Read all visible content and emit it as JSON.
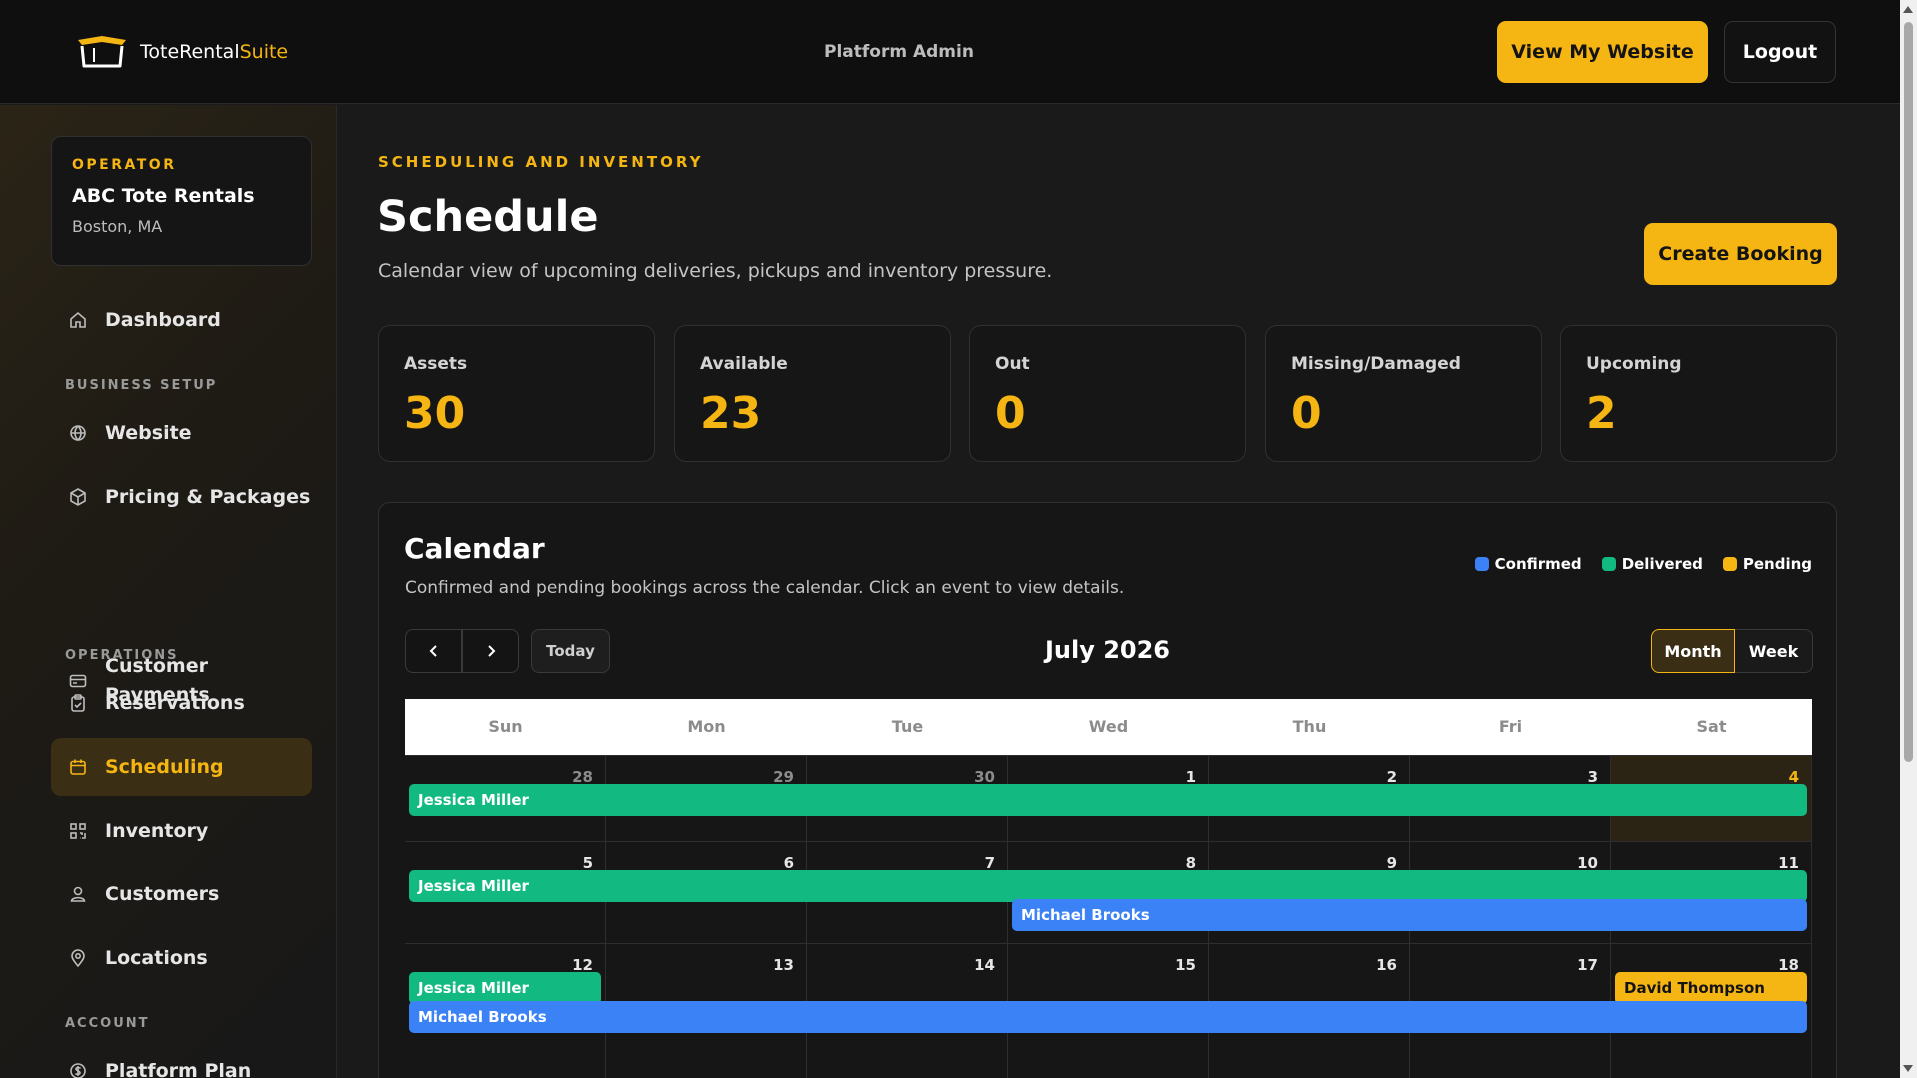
{
  "header": {
    "logo_text_main": "ToteRental",
    "logo_text_accent": "Suite",
    "center_label": "Platform Admin",
    "view_site_label": "View My Website",
    "logout_label": "Logout",
    "accent_color": "#f5b512"
  },
  "operator": {
    "kicker": "OPERATOR",
    "name": "ABC Tote Rentals",
    "location": "Boston, MA"
  },
  "sidebar": {
    "dashboard": "Dashboard",
    "section_business": "BUSINESS SETUP",
    "website": "Website",
    "pricing": "Pricing & Packages",
    "payments_line1": "Customer",
    "payments_line2": "Payments",
    "section_operations": "OPERATIONS",
    "reservations": "Reservations",
    "scheduling": "Scheduling",
    "inventory": "Inventory",
    "customers": "Customers",
    "locations": "Locations",
    "section_account": "ACCOUNT",
    "platform_plan": "Platform Plan"
  },
  "page": {
    "kicker": "SCHEDULING AND INVENTORY",
    "title": "Schedule",
    "subtitle": "Calendar view of upcoming deliveries, pickups and inventory pressure.",
    "create_label": "Create Booking"
  },
  "stats": [
    {
      "label": "Assets",
      "value": "30"
    },
    {
      "label": "Available",
      "value": "23"
    },
    {
      "label": "Out",
      "value": "0"
    },
    {
      "label": "Missing/Damaged",
      "value": "0"
    },
    {
      "label": "Upcoming",
      "value": "2"
    }
  ],
  "calendar": {
    "title": "Calendar",
    "subtitle": "Confirmed and pending bookings across the calendar. Click an event to view details.",
    "legend": [
      {
        "label": "Confirmed",
        "color": "#3b82f6"
      },
      {
        "label": "Delivered",
        "color": "#12b981"
      },
      {
        "label": "Pending",
        "color": "#f5b512"
      }
    ],
    "today_label": "Today",
    "month_label": "July 2026",
    "view_month": "Month",
    "view_week": "Week",
    "weekdays": [
      "Sun",
      "Mon",
      "Tue",
      "Wed",
      "Thu",
      "Fri",
      "Sat"
    ],
    "weeks": [
      {
        "days": [
          {
            "num": "28",
            "muted": true
          },
          {
            "num": "29",
            "muted": true
          },
          {
            "num": "30",
            "muted": true
          },
          {
            "num": "1"
          },
          {
            "num": "2"
          },
          {
            "num": "3"
          },
          {
            "num": "4",
            "today": true
          }
        ],
        "events": [
          {
            "title": "Jessica Miller",
            "status": "delivered",
            "start": 0,
            "span": 7,
            "lane": 0
          }
        ]
      },
      {
        "days": [
          {
            "num": "5"
          },
          {
            "num": "6"
          },
          {
            "num": "7"
          },
          {
            "num": "8"
          },
          {
            "num": "9"
          },
          {
            "num": "10"
          },
          {
            "num": "11"
          }
        ],
        "events": [
          {
            "title": "Jessica Miller",
            "status": "delivered",
            "start": 0,
            "span": 7,
            "lane": 0
          },
          {
            "title": "Michael Brooks",
            "status": "confirmed",
            "start": 3,
            "span": 4,
            "lane": 1
          }
        ]
      },
      {
        "days": [
          {
            "num": "12"
          },
          {
            "num": "13"
          },
          {
            "num": "14"
          },
          {
            "num": "15"
          },
          {
            "num": "16"
          },
          {
            "num": "17"
          },
          {
            "num": "18"
          }
        ],
        "events": [
          {
            "title": "Jessica Miller",
            "status": "delivered",
            "start": 0,
            "span": 1,
            "lane": 0
          },
          {
            "title": "David Thompson",
            "status": "pending",
            "start": 6,
            "span": 1,
            "lane": 0
          },
          {
            "title": "Michael Brooks",
            "status": "confirmed",
            "start": 0,
            "span": 7,
            "lane": 1
          }
        ]
      }
    ]
  }
}
